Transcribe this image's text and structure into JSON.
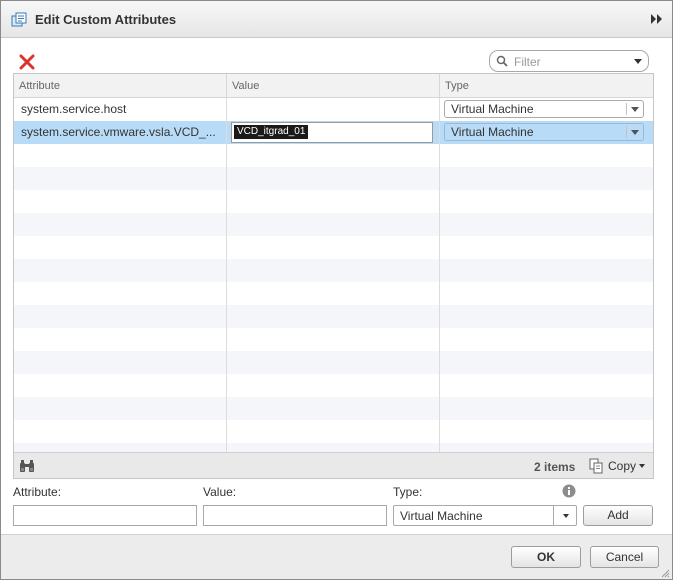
{
  "dialog": {
    "title": "Edit Custom Attributes"
  },
  "toolbar": {
    "delete_icon": "red-x-icon",
    "filter_placeholder": "Filter"
  },
  "grid": {
    "columns": [
      "Attribute",
      "Value",
      "Type"
    ],
    "rows": [
      {
        "attribute": "system.service.host",
        "value": "",
        "type": "Virtual Machine",
        "selected": false
      },
      {
        "attribute": "system.service.vmware.vsla.VCD_...",
        "value": "VCD_itgrad_01",
        "type": "Virtual Machine",
        "selected": true,
        "editing": true
      }
    ],
    "item_count": "2 items",
    "copy_label": "Copy"
  },
  "form": {
    "attribute_label": "Attribute:",
    "value_label": "Value:",
    "type_label": "Type:",
    "attribute_value": "",
    "value_value": "",
    "type_selected": "Virtual Machine",
    "add_label": "Add"
  },
  "footer": {
    "ok_label": "OK",
    "cancel_label": "Cancel"
  },
  "colors": {
    "selection": "#b8dcf7",
    "delete_red": "#d9342b",
    "info_gray": "#8c8c8c"
  }
}
